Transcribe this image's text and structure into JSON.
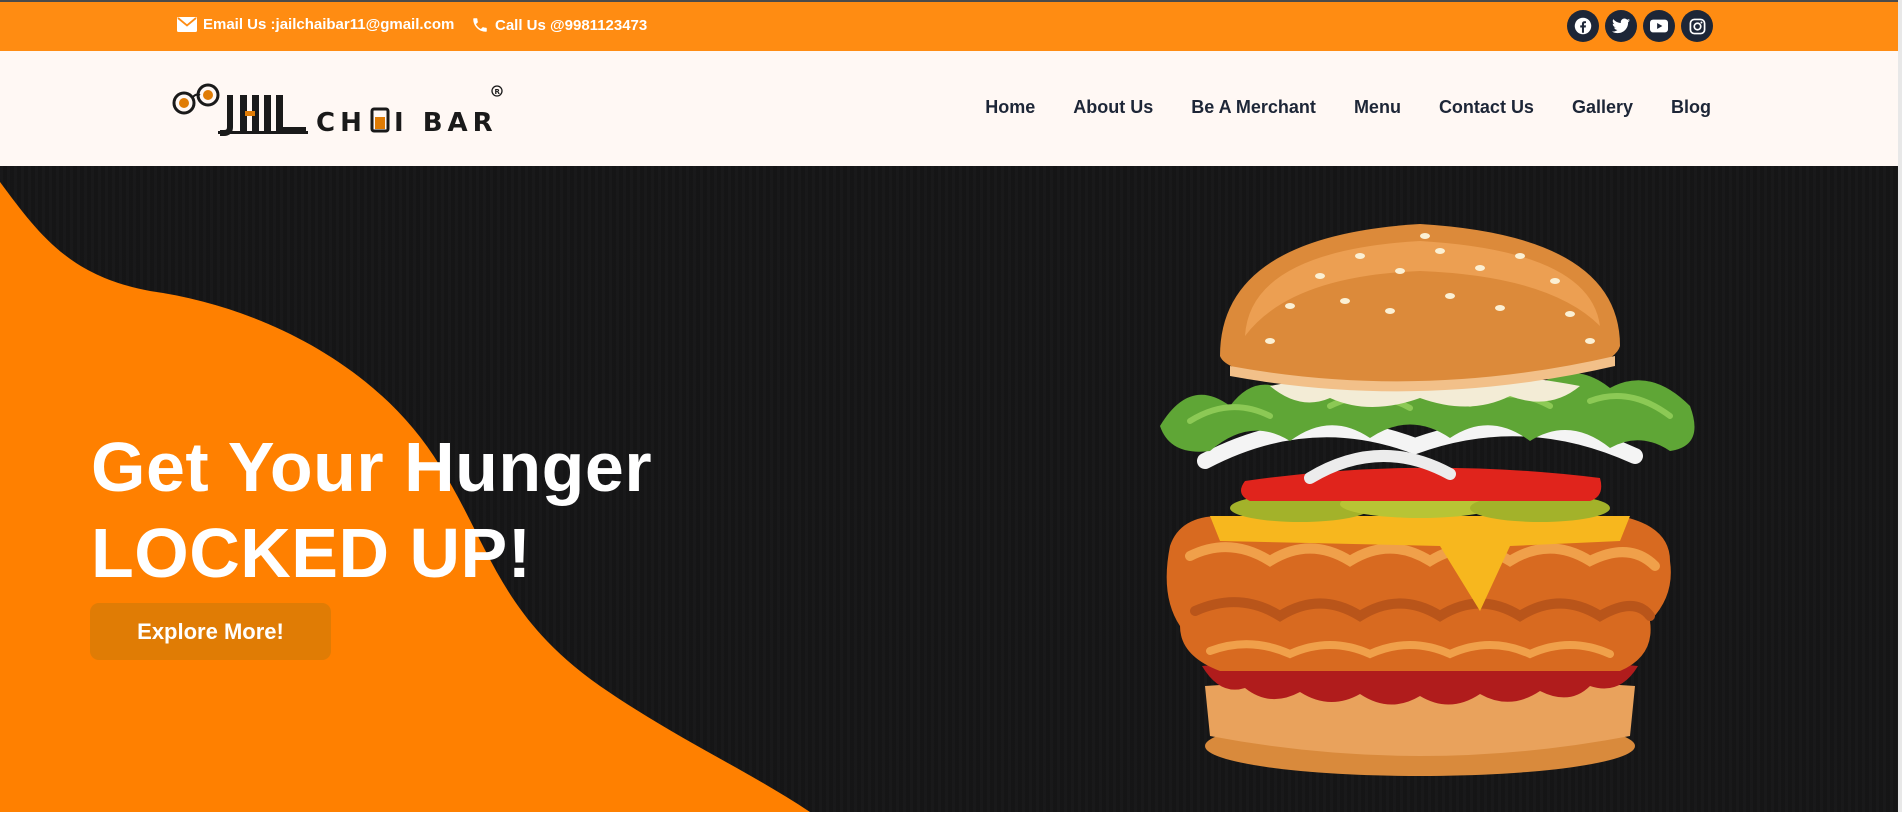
{
  "topbar": {
    "email_text": "Email Us :jailchaibar11@gmail.com",
    "phone_text": "Call Us @9981123473",
    "socials": [
      "facebook-icon",
      "twitter-icon",
      "youtube-icon",
      "instagram-icon"
    ],
    "background": "#ff8c12"
  },
  "header": {
    "logo_text": "JAIL CHAI BAR",
    "nav": [
      "Home",
      "About Us",
      "Be A Merchant",
      "Menu",
      "Contact Us",
      "Gallery",
      "Blog"
    ],
    "nav_color": "#1d2637"
  },
  "hero": {
    "headline_line1": "Get Your Hunger",
    "headline_line2": "LOCKED UP!",
    "cta_label": "Explore More!",
    "accent": "#ff8000",
    "background": "#161617"
  }
}
